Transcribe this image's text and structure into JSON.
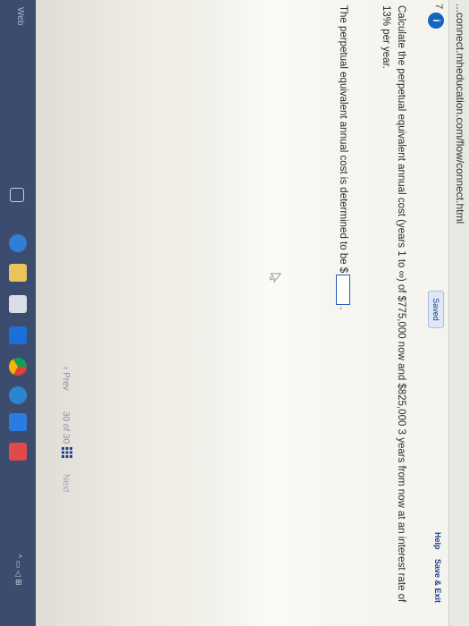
{
  "browser": {
    "url": "...connect.mheducation.com/flow/connect.html"
  },
  "header": {
    "question_number": "7",
    "info_label": "i",
    "saved_label": "Saved",
    "help_label": "Help",
    "save_exit_label": "Save & Exit"
  },
  "question": {
    "text": "Calculate the perpetual equivalent annual cost (years 1 to ∞) of $775,000 now and $825,000 3 years from now at an interest rate of 13% per year.",
    "answer_prompt": "The perpetual equivalent annual cost is determined to be $",
    "answer_value": "",
    "answer_suffix": "."
  },
  "footer": {
    "prev_label": "‹ Prev",
    "page_current": "30",
    "page_of": "of",
    "page_total": "30",
    "next_label": "Next"
  },
  "taskbar": {
    "search_label": "Web",
    "accent": "#3c4c6e",
    "icons": [
      "edge-icon",
      "file-explorer-icon",
      "store-icon",
      "chrome-icon",
      "ie-icon",
      "teams-icon",
      "app-icon"
    ]
  }
}
